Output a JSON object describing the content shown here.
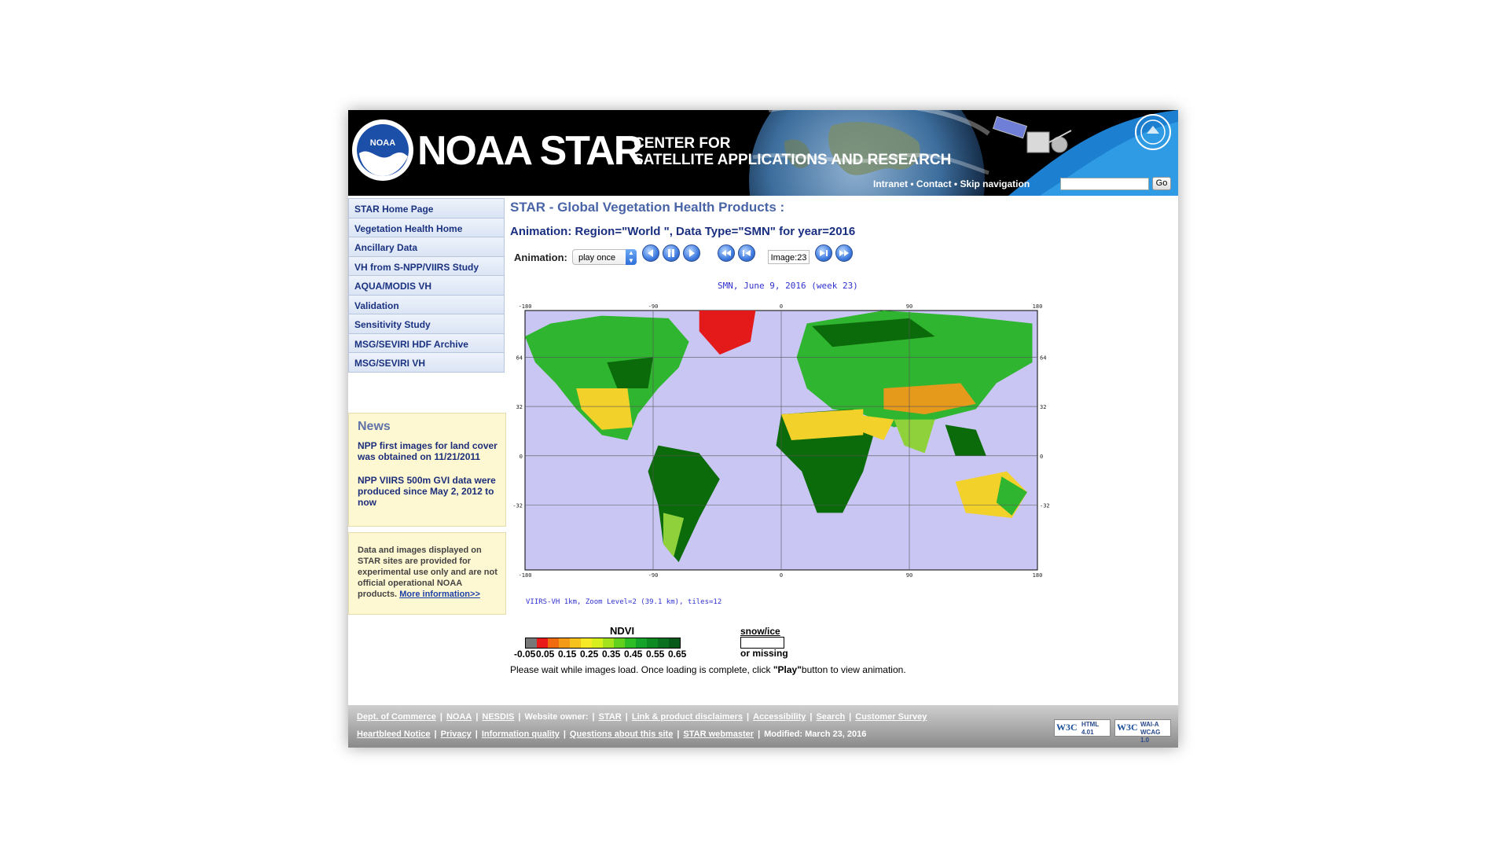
{
  "header": {
    "brand": "NOAA STAR",
    "subtitle_line1": "CENTER FOR",
    "subtitle_line2": "SATELLITE APPLICATIONS AND RESEARCH",
    "logo_text": "NOAA",
    "links": [
      "Intranet",
      "Contact",
      "Skip navigation"
    ],
    "link_separator": "•",
    "search_placeholder": "",
    "go_label": "Go"
  },
  "nav": {
    "items": [
      "STAR Home Page",
      "Vegetation Health Home",
      "Ancillary Data",
      "VH from S-NPP/VIIRS Study",
      "AQUA/MODIS VH",
      "Validation",
      "Sensitivity Study",
      "MSG/SEVIRI HDF Archive",
      "MSG/SEVIRI VH"
    ]
  },
  "news": {
    "title": "News",
    "items": [
      "NPP first images for land cover was obtained on 11/21/2011",
      "NPP VIIRS 500m GVI data were produced since May 2, 2012 to now"
    ]
  },
  "disclaimer": {
    "text": "Data and images displayed on STAR sites are provided for experimental use only and are not official operational NOAA products.",
    "link": "More information>>"
  },
  "main": {
    "title": "STAR - Global Vegetation Health Products :",
    "animation_title": "Animation: Region=\"World \", Data Type=\"SMN\" for year=2016",
    "animation_label": "Animation:",
    "play_mode": "play once",
    "image_counter": "Image:23",
    "wait_text_before": "Please wait while images load. Once loading is complete, click ",
    "wait_text_bold": "\"Play\"",
    "wait_text_after": "button to view animation."
  },
  "map": {
    "title": "SMN, June 9, 2016 (week 23)",
    "credit": "VIIRS-VH 1km, Zoom Level=2 (39.1 km), tiles=12",
    "lon_ticks": [
      "-180",
      "-90",
      "0",
      "90",
      "180"
    ],
    "lat_ticks": [
      "64",
      "32",
      "0",
      "-32"
    ],
    "colors": {
      "ocean": "#c9c6f4",
      "ice": "#e41a1a",
      "veg_high": "#0b6b0b",
      "veg_mid": "#2fb52f",
      "veg_low": "#8fd13a",
      "dry": "#f2d22a",
      "arid": "#e59a1c"
    }
  },
  "legend": {
    "title": "NDVI",
    "colors": [
      "#777777",
      "#e81a1a",
      "#f06a10",
      "#f39b16",
      "#f6c21e",
      "#f7e925",
      "#d8ef1e",
      "#a3e21d",
      "#62d11e",
      "#2fbd25",
      "#15a32a",
      "#0e8a23",
      "#0b7020",
      "#085a1a"
    ],
    "ticks": [
      "-0.05",
      "0.05",
      "0.15",
      "0.25",
      "0.35",
      "0.45",
      "0.55",
      "0.65"
    ],
    "snow_label": "snow/ice",
    "missing_label": "or missing"
  },
  "footer": {
    "row1": [
      {
        "text": "Dept. of Commerce",
        "link": true
      },
      {
        "text": "NOAA",
        "link": true
      },
      {
        "text": "NESDIS",
        "link": true
      },
      {
        "text": "Website owner:",
        "link": false
      },
      {
        "text": "STAR",
        "link": true
      },
      {
        "text": "Link & product disclaimers",
        "link": true
      },
      {
        "text": "Accessibility",
        "link": true
      },
      {
        "text": "Search",
        "link": true
      },
      {
        "text": "Customer Survey",
        "link": true
      }
    ],
    "row2": [
      {
        "text": "Heartbleed Notice",
        "link": true
      },
      {
        "text": "Privacy",
        "link": true
      },
      {
        "text": "Information quality",
        "link": true
      },
      {
        "text": "Questions about this site",
        "link": true
      },
      {
        "text": "STAR webmaster",
        "link": true
      },
      {
        "text": "Modified: March 23, 2016",
        "link": false
      }
    ],
    "badge1": {
      "w3": "W3C",
      "line1": "HTML",
      "line2": "4.01"
    },
    "badge2": {
      "w3": "W3C",
      "line1": "WAI-A",
      "line2": "WCAG 1.0"
    }
  }
}
